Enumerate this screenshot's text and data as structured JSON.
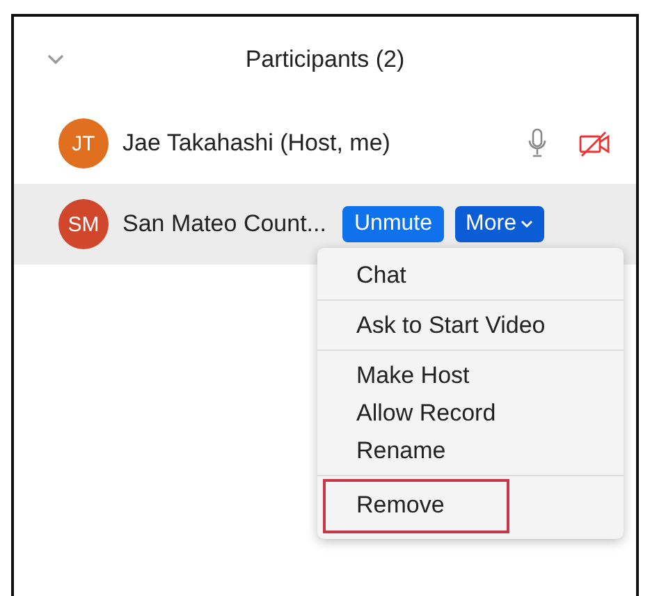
{
  "header": {
    "title": "Participants (2)"
  },
  "participants": [
    {
      "initials": "JT",
      "name": "Jae Takahashi (Host, me)",
      "color": "#e07020",
      "selected": false,
      "video_off": true
    },
    {
      "initials": "SM",
      "name": "San Mateo Count...",
      "color": "#d0472c",
      "selected": true,
      "buttons": [
        {
          "label": "Unmute",
          "kind": "plain"
        },
        {
          "label": "More",
          "kind": "dropdown"
        }
      ]
    }
  ],
  "menu": {
    "groups": [
      [
        {
          "label": "Chat",
          "highlighted": false
        }
      ],
      [
        {
          "label": "Ask to Start Video",
          "highlighted": false
        }
      ],
      [
        {
          "label": "Make Host",
          "highlighted": false
        },
        {
          "label": "Allow Record",
          "highlighted": false
        },
        {
          "label": "Rename",
          "highlighted": false
        }
      ],
      [
        {
          "label": "Remove",
          "highlighted": true
        }
      ]
    ]
  }
}
